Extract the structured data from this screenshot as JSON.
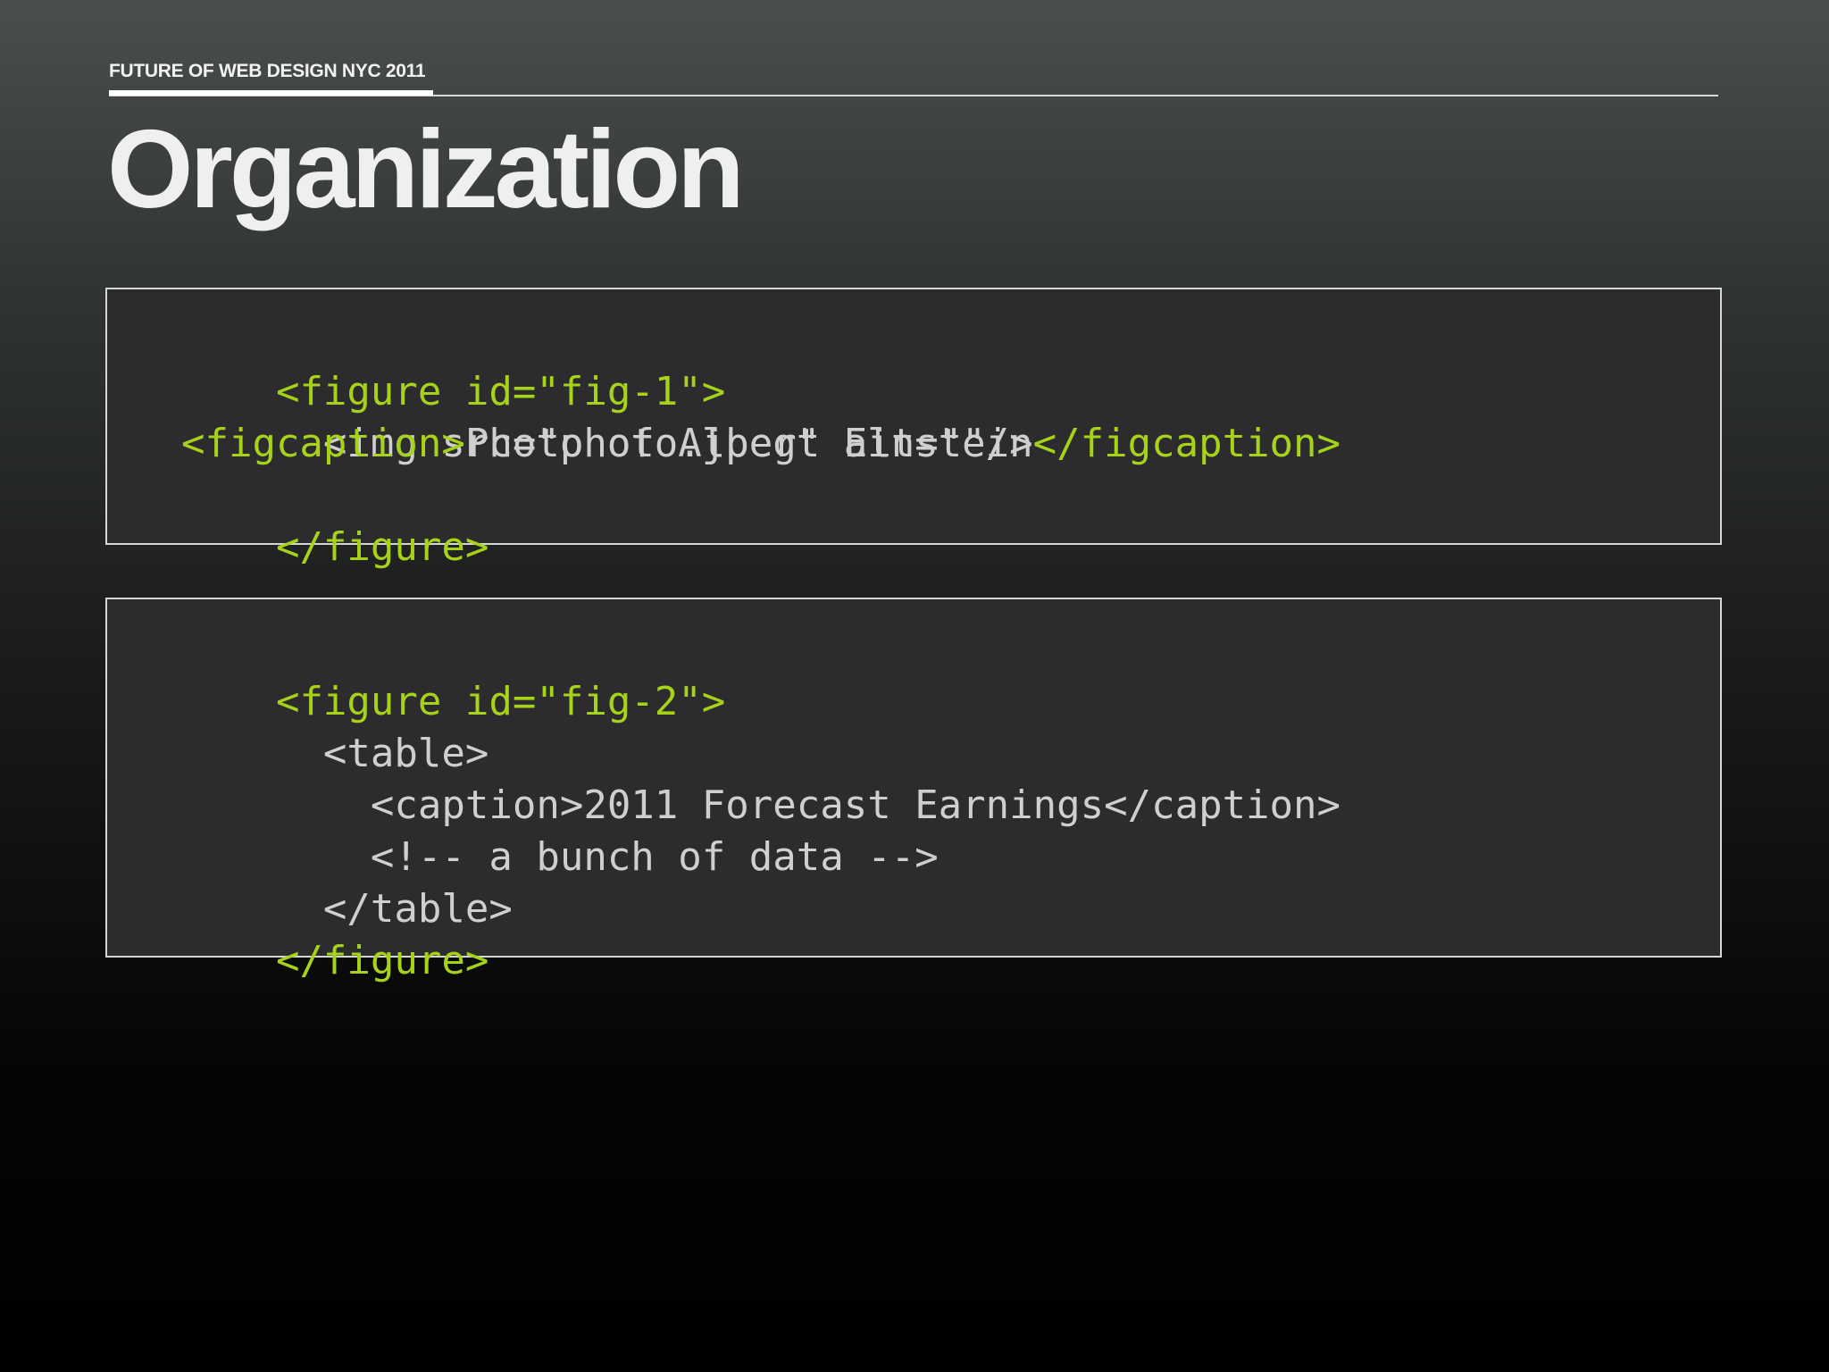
{
  "header": {
    "label": "FUTURE OF WEB DESIGN NYC 2011"
  },
  "title": "Organization",
  "colors": {
    "accent_green": "#a6d21a",
    "code_text": "#cfcfcf",
    "box_background": "#2c2c2e",
    "box_border": "#d6d6d6"
  },
  "code_block_1": {
    "lines": [
      [
        {
          "text": "<figure id=\"fig-1\">",
          "style": "green"
        }
      ],
      [
        {
          "text": "  <img src=\"photo.jpeg\" alt=\"\"/>",
          "style": "gray"
        }
      ],
      [
        {
          "text": "  <figcaption>",
          "style": "green"
        },
        {
          "text": "Photo of Albert Einstein",
          "style": "gray"
        },
        {
          "text": "</figcaption>",
          "style": "green"
        }
      ],
      [
        {
          "text": "</figure>",
          "style": "green"
        }
      ]
    ]
  },
  "code_block_2": {
    "lines": [
      [
        {
          "text": "<figure id=\"fig-2\">",
          "style": "green"
        }
      ],
      [
        {
          "text": "  <table>",
          "style": "gray"
        }
      ],
      [
        {
          "text": "    <caption>2011 Forecast Earnings</caption>",
          "style": "gray"
        }
      ],
      [
        {
          "text": "    <!-- a bunch of data -->",
          "style": "gray"
        }
      ],
      [
        {
          "text": "  </table>",
          "style": "gray"
        }
      ],
      [
        {
          "text": "</figure>",
          "style": "green"
        }
      ]
    ]
  }
}
